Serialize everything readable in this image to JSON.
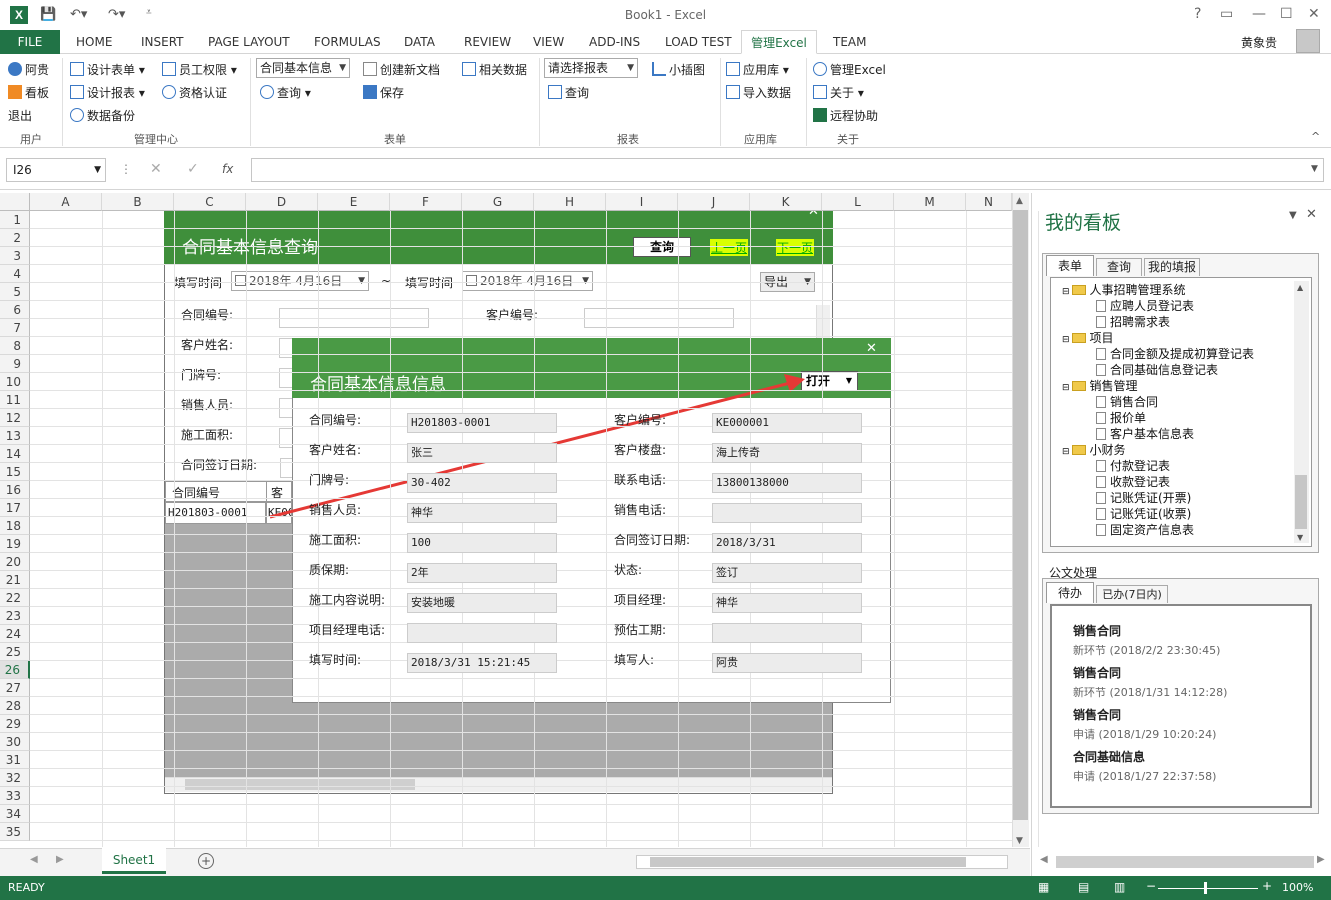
{
  "titlebar": {
    "title": "Book1 - Excel",
    "help": "?",
    "user": "黄象贵"
  },
  "ribbon_tabs": [
    "FILE",
    "HOME",
    "INSERT",
    "PAGE LAYOUT",
    "FORMULAS",
    "DATA",
    "REVIEW",
    "VIEW",
    "ADD-INS",
    "LOAD TEST",
    "管理Excel",
    "TEAM"
  ],
  "ribbon": {
    "user_group": {
      "items": [
        "阿贵",
        "看板",
        "退出"
      ],
      "label": "用户"
    },
    "manage_group": {
      "items": [
        "设计表单",
        "员工权限",
        "设计报表",
        "资格认证",
        "数据备份"
      ],
      "label": "管理中心"
    },
    "form_group": {
      "combo": "合同基本信息",
      "new_doc": "创建新文档",
      "query": "查询",
      "save": "保存",
      "related": "相关数据",
      "label": "表单"
    },
    "report_group": {
      "combo": "请选择报表",
      "query": "查询",
      "chart": "小插图",
      "label": "报表"
    },
    "app_group": {
      "app_store": "应用库",
      "import": "导入数据",
      "label": "应用库"
    },
    "about_group": {
      "manage": "管理Excel",
      "about": "关于",
      "remote": "远程协助",
      "label": "关于"
    }
  },
  "formula_bar": {
    "name_box": "I26",
    "cancel": "✕",
    "enter": "✓",
    "fx": "fx",
    "formula": ""
  },
  "columns": [
    "A",
    "B",
    "C",
    "D",
    "E",
    "F",
    "G",
    "H",
    "I",
    "J",
    "K",
    "L",
    "M",
    "N"
  ],
  "rows": [
    "1",
    "2",
    "3",
    "4",
    "5",
    "6",
    "7",
    "8",
    "9",
    "10",
    "11",
    "12",
    "13",
    "14",
    "15",
    "16",
    "17",
    "18",
    "19",
    "20",
    "21",
    "22",
    "23",
    "24",
    "25",
    "26",
    "27",
    "28",
    "29",
    "30",
    "31",
    "32",
    "33",
    "34",
    "35"
  ],
  "active_row": "26",
  "sheet_tab": "Sheet1",
  "status": {
    "text": "READY",
    "zoom": "100%"
  },
  "query_dialog": {
    "title": "合同基本信息查询",
    "query_btn": "查询",
    "prev": "上一页",
    "next": "下一页",
    "date_label1": "填写时间",
    "date_from": "2018年 4月16日",
    "tilde": "~",
    "date_label2": "填写时间",
    "date_to": "2018年 4月16日",
    "export": "导出",
    "labels": [
      "合同编号:",
      "客户编号:",
      "客户姓名:",
      "门牌号:",
      "销售人员:",
      "施工面积:",
      "合同签订日期:"
    ],
    "table_headers": [
      "合同编号",
      "客户"
    ],
    "table_row": [
      "H201803-0001",
      "KE00"
    ]
  },
  "info_dialog": {
    "title": "合同基本信息信息",
    "open_btn": "打开",
    "left": [
      {
        "label": "合同编号:",
        "value": "H201803-0001"
      },
      {
        "label": "客户姓名:",
        "value": "张三"
      },
      {
        "label": "门牌号:",
        "value": "30-402"
      },
      {
        "label": "销售人员:",
        "value": "神华"
      },
      {
        "label": "施工面积:",
        "value": "100"
      },
      {
        "label": "质保期:",
        "value": "2年"
      },
      {
        "label": "施工内容说明:",
        "value": "安装地暖"
      },
      {
        "label": "项目经理电话:",
        "value": ""
      },
      {
        "label": "填写时间:",
        "value": "2018/3/31 15:21:45"
      }
    ],
    "right": [
      {
        "label": "客户编号:",
        "value": "KE000001"
      },
      {
        "label": "客户楼盘:",
        "value": "海上传奇"
      },
      {
        "label": "联系电话:",
        "value": "13800138000"
      },
      {
        "label": "销售电话:",
        "value": ""
      },
      {
        "label": "合同签订日期:",
        "value": "2018/3/31"
      },
      {
        "label": "状态:",
        "value": "签订"
      },
      {
        "label": "项目经理:",
        "value": "神华"
      },
      {
        "label": "预估工期:",
        "value": ""
      },
      {
        "label": "填写人:",
        "value": "阿贵"
      }
    ]
  },
  "pane": {
    "title": "我的看板",
    "tabs": [
      "表单",
      "查询",
      "我的填报"
    ],
    "tree": [
      {
        "folder": "人事招聘管理系统",
        "items": [
          "应聘人员登记表",
          "招聘需求表"
        ]
      },
      {
        "folder": "项目",
        "items": [
          "合同金额及提成初算登记表",
          "合同基础信息登记表"
        ]
      },
      {
        "folder": "销售管理",
        "items": [
          "销售合同",
          "报价单",
          "客户基本信息表"
        ]
      },
      {
        "folder": "小财务",
        "items": [
          "付款登记表",
          "收款登记表",
          "记账凭证(开票)",
          "记账凭证(收票)",
          "固定资产信息表"
        ]
      }
    ],
    "doc_section": "公文处理",
    "doc_tabs": [
      "待办",
      "已办(7日内)"
    ],
    "todos": [
      {
        "title": "销售合同",
        "sub": "新环节 (2018/2/2 23:30:45)"
      },
      {
        "title": "销售合同",
        "sub": "新环节 (2018/1/31 14:12:28)"
      },
      {
        "title": "销售合同",
        "sub": "申请 (2018/1/29 10:20:24)"
      },
      {
        "title": "合同基础信息",
        "sub": "申请 (2018/1/27 22:37:58)"
      }
    ]
  },
  "colors": {
    "excel_green": "#217346",
    "dialog_green": "#4a9a45",
    "arrow": "#e53935"
  }
}
